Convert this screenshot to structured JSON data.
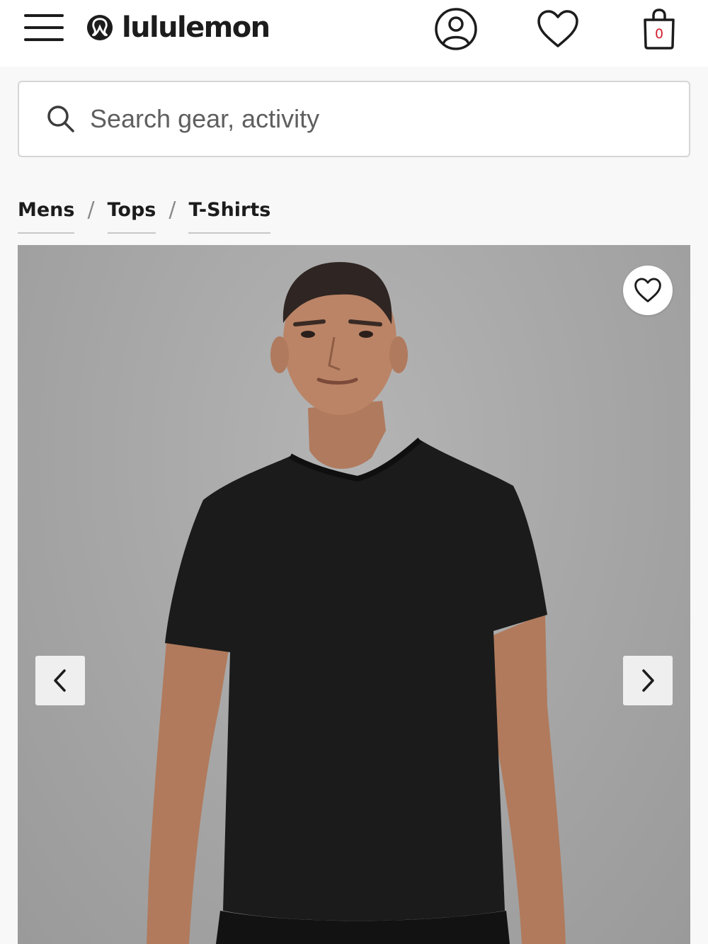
{
  "header": {
    "brand_name": "lululemon",
    "bag_count": "0",
    "icons": {
      "menu": "hamburger-menu-icon",
      "logo": "lululemon-logo-icon",
      "account": "user-icon",
      "wishlist": "heart-icon",
      "bag": "shopping-bag-icon"
    }
  },
  "search": {
    "placeholder": "Search gear, activity",
    "value": "",
    "icon": "search-icon"
  },
  "breadcrumb": {
    "items": [
      "Mens",
      "Tops",
      "T-Shirts"
    ],
    "separator": "/"
  },
  "gallery": {
    "image": "man-wearing-black-v-neck-t-shirt",
    "icons": {
      "favorite": "heart-icon",
      "previous": "chevron-left-icon",
      "next": "chevron-right-icon"
    }
  },
  "colors": {
    "text": "#1c1c1c",
    "bag_count": "#d22030",
    "photo_background": "#aaaaaa",
    "shirt": "#1b1b1b"
  }
}
